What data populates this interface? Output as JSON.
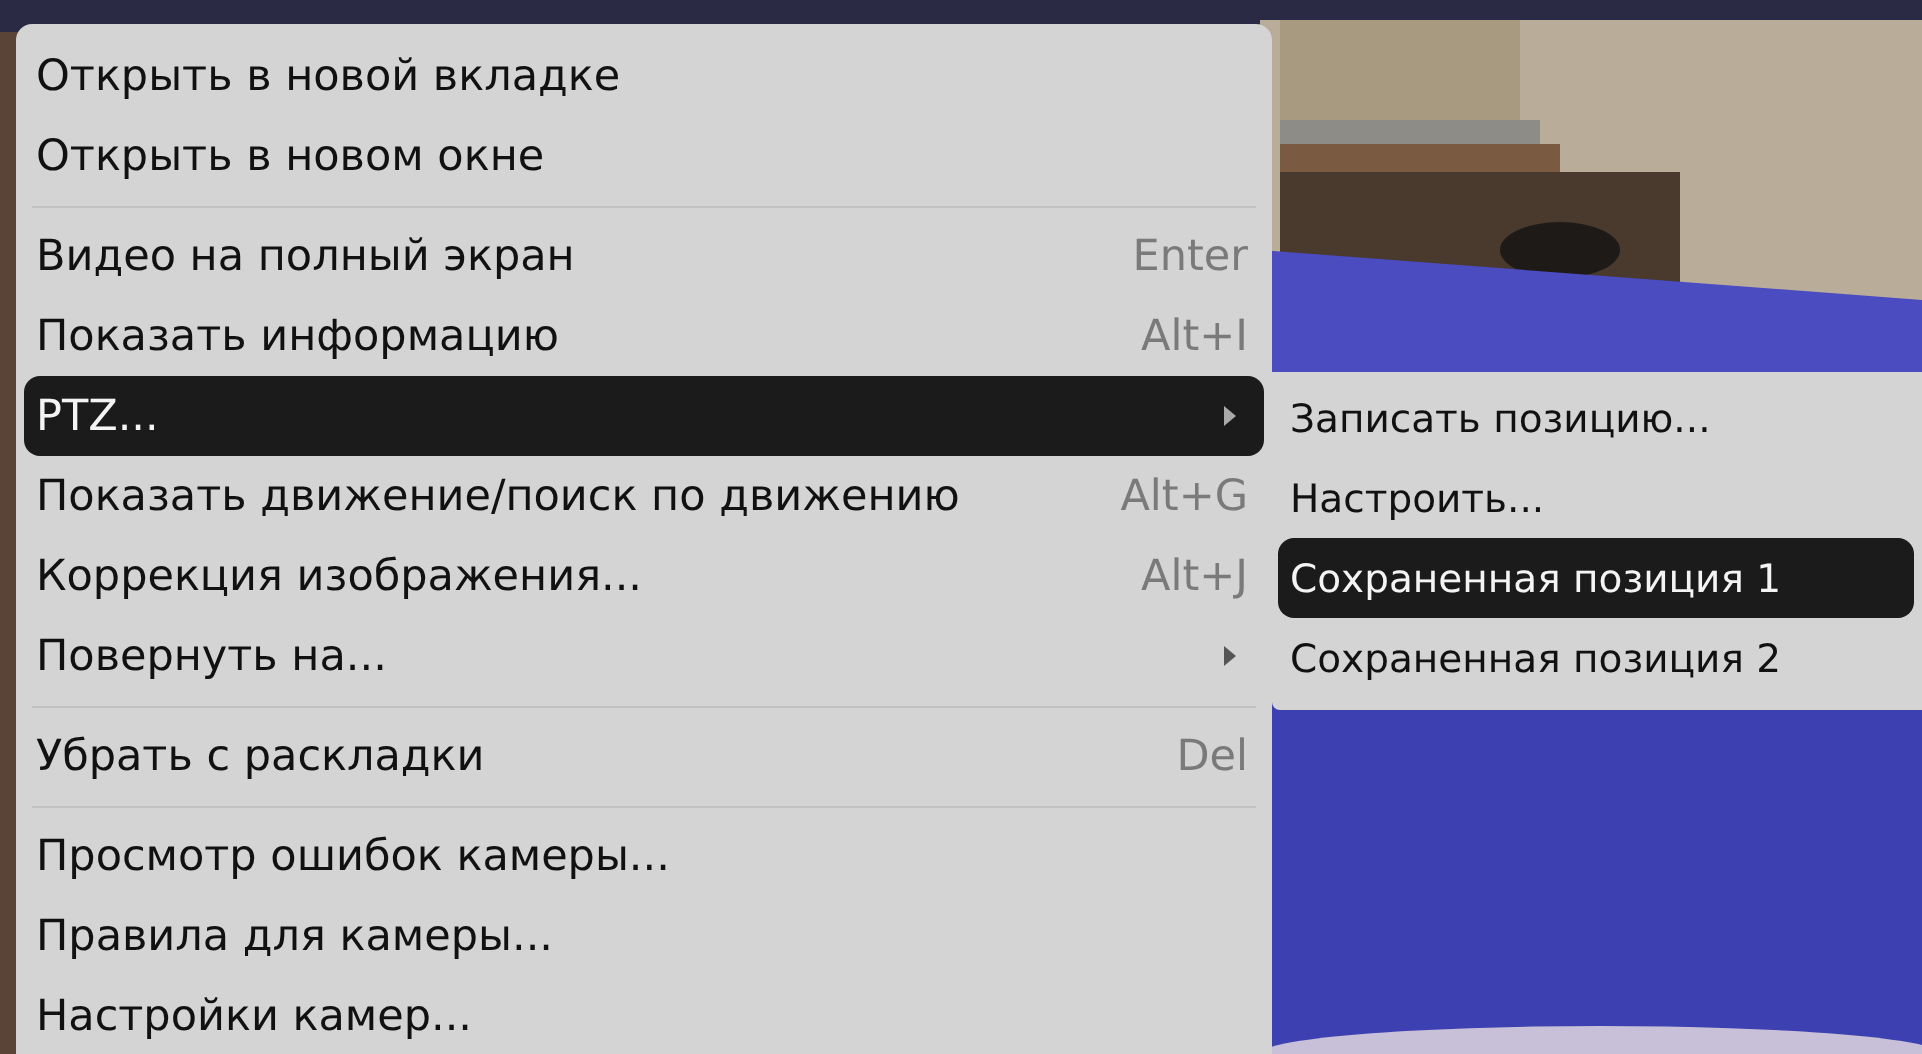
{
  "context_menu": {
    "items": [
      {
        "kind": "item",
        "label": "Открыть в новой вкладке",
        "selected": false
      },
      {
        "kind": "item",
        "label": "Открыть в новом окне",
        "selected": false
      },
      {
        "kind": "separator"
      },
      {
        "kind": "item",
        "label": "Видео на полный экран",
        "shortcut": "Enter",
        "selected": false
      },
      {
        "kind": "item",
        "label": "Показать информацию",
        "shortcut": "Alt+I",
        "selected": false
      },
      {
        "kind": "item",
        "label": "PTZ...",
        "has_submenu": true,
        "selected": true
      },
      {
        "kind": "item",
        "label": "Показать движение/поиск по движению",
        "shortcut": "Alt+G",
        "selected": false
      },
      {
        "kind": "item",
        "label": "Коррекция изображения...",
        "shortcut": "Alt+J",
        "selected": false
      },
      {
        "kind": "item",
        "label": "Повернуть на...",
        "has_submenu": true,
        "selected": false
      },
      {
        "kind": "separator"
      },
      {
        "kind": "item",
        "label": "Убрать с раскладки",
        "shortcut": "Del",
        "selected": false
      },
      {
        "kind": "separator"
      },
      {
        "kind": "item",
        "label": "Просмотр ошибок камеры...",
        "selected": false
      },
      {
        "kind": "item",
        "label": "Правила для камеры...",
        "selected": false
      },
      {
        "kind": "item",
        "label": "Настройки камер...",
        "selected": false
      }
    ]
  },
  "submenu": {
    "items": [
      {
        "label": "Записать позицию...",
        "selected": false
      },
      {
        "label": "Настроить...",
        "selected": false
      },
      {
        "label": "Сохраненная позиция 1",
        "selected": true
      },
      {
        "label": "Сохраненная позиция 2",
        "selected": false
      }
    ]
  }
}
